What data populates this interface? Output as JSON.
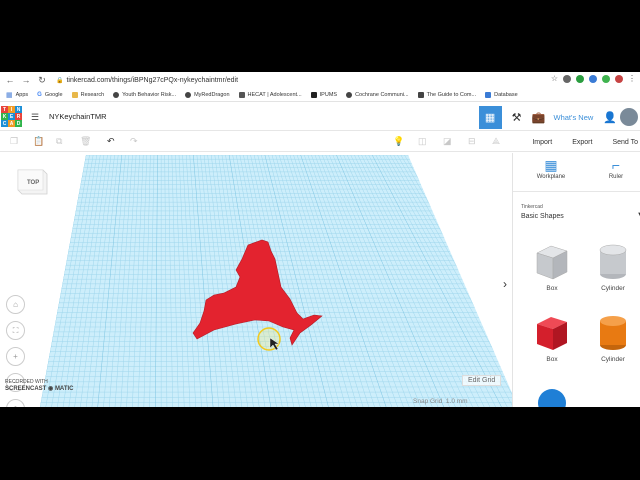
{
  "browser": {
    "url": "tinkercad.com/things/iBPNg27cPQx-nykeychaintmr/edit",
    "bookmarks": [
      {
        "label": "Apps",
        "color": "#4a7fd6"
      },
      {
        "label": "Google",
        "color": "#4285f4"
      },
      {
        "label": "Research",
        "color": "#e8b84a"
      },
      {
        "label": "Youth Behavior Risk...",
        "color": "#444444"
      },
      {
        "label": "MyRedDragon",
        "color": "#444444"
      },
      {
        "label": "HECAT | Adolescent...",
        "color": "#555555"
      },
      {
        "label": "IPUMS",
        "color": "#222222"
      },
      {
        "label": "Cochrane Communi...",
        "color": "#444444"
      },
      {
        "label": "The Guide to Com...",
        "color": "#444444"
      },
      {
        "label": "Database",
        "color": "#3a7bd5"
      }
    ]
  },
  "app": {
    "logo_letters": [
      "T",
      "I",
      "N",
      "K",
      "E",
      "R",
      "C",
      "A",
      "D"
    ],
    "design_name": "NYKeychainTMR",
    "whats_new": "What's New",
    "accent": "#3b8fd9"
  },
  "toolbar": {
    "import_label": "Import",
    "export_label": "Export",
    "send_to_label": "Send To"
  },
  "canvas": {
    "viewcube_label": "TOP",
    "edit_grid_label": "Edit Grid",
    "snap_grid_label": "Snap Grid",
    "snap_value": "1.0 mm",
    "shape_color": "#e3232f",
    "grid_color": "#bfe6f5",
    "watermark_line1": "RECORDED WITH",
    "watermark_line2": "SCREENCAST",
    "watermark_line3": "MATIC"
  },
  "panel": {
    "workplane_label": "Workplane",
    "ruler_label": "Ruler",
    "library_source": "Tinkercad",
    "library_selected": "Basic Shapes",
    "shapes": [
      {
        "label": "Box",
        "color": "#c9ccd0",
        "kind": "box-gray"
      },
      {
        "label": "Cylinder",
        "color": "#c9ccd0",
        "kind": "cyl-gray"
      },
      {
        "label": "Box",
        "color": "#d41f2c",
        "kind": "box-red"
      },
      {
        "label": "Cylinder",
        "color": "#e87a12",
        "kind": "cyl-orange"
      }
    ]
  }
}
